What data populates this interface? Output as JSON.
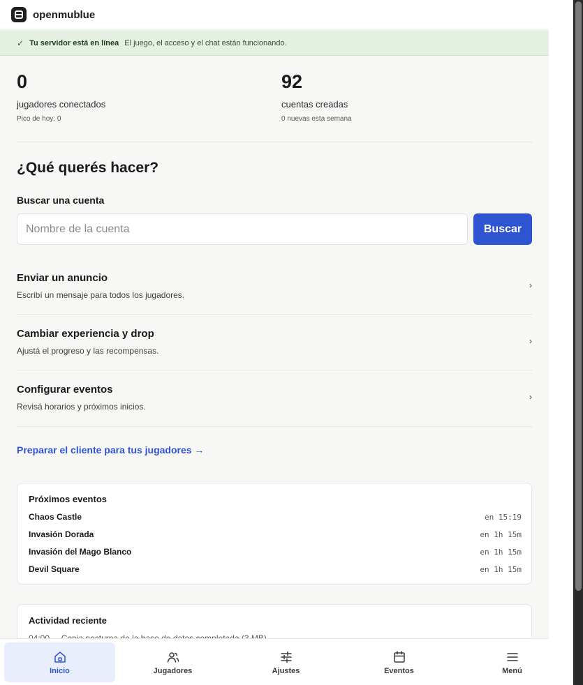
{
  "app": {
    "brand": "openmublue"
  },
  "status": {
    "check": "✓",
    "title": "Tu servidor está en línea",
    "message": "El juego, el acceso y el chat están funcionando."
  },
  "stats": [
    {
      "value": "0",
      "label": "jugadores conectados",
      "sub": "Pico de hoy: 0"
    },
    {
      "value": "92",
      "label": "cuentas creadas",
      "sub": "0 nuevas esta semana"
    }
  ],
  "actions_heading": "¿Qué querés hacer?",
  "search": {
    "label": "Buscar una cuenta",
    "placeholder": "Nombre de la cuenta",
    "value": "",
    "button": "Buscar"
  },
  "actions": [
    {
      "title": "Enviar un anuncio",
      "desc": "Escribí un mensaje para todos los jugadores.",
      "chevron": "›"
    },
    {
      "title": "Cambiar experiencia y drop",
      "desc": "Ajustá el progreso y las recompensas.",
      "chevron": "›"
    },
    {
      "title": "Configurar eventos",
      "desc": "Revisá horarios y próximos inicios.",
      "chevron": "›"
    }
  ],
  "client_link": "Preparar el cliente para tus jugadores →",
  "upcoming": {
    "title": "Próximos eventos",
    "events": [
      {
        "name": "Chaos Castle",
        "time": "en 15:19"
      },
      {
        "name": "Invasión Dorada",
        "time": "en 1h 15m"
      },
      {
        "name": "Invasión del Mago Blanco",
        "time": "en 1h 15m"
      },
      {
        "name": "Devil Square",
        "time": "en 1h 15m"
      }
    ]
  },
  "activity": {
    "title": "Actividad reciente",
    "items": [
      {
        "time": "04:00",
        "text": "Copia nocturna de la base de datos completada (3 MB)"
      }
    ]
  },
  "nav": [
    {
      "label": "Inicio",
      "icon": "home-icon",
      "active": true
    },
    {
      "label": "Jugadores",
      "icon": "players-icon",
      "active": false
    },
    {
      "label": "Ajustes",
      "icon": "sliders-icon",
      "active": false
    },
    {
      "label": "Eventos",
      "icon": "calendar-icon",
      "active": false
    },
    {
      "label": "Menú",
      "icon": "menu-icon",
      "active": false
    }
  ],
  "colors": {
    "accent": "#2f54d1",
    "status_bg": "#e4f0e1",
    "background": "#f7f7f5",
    "active_nav_bg": "#e8eefb"
  }
}
